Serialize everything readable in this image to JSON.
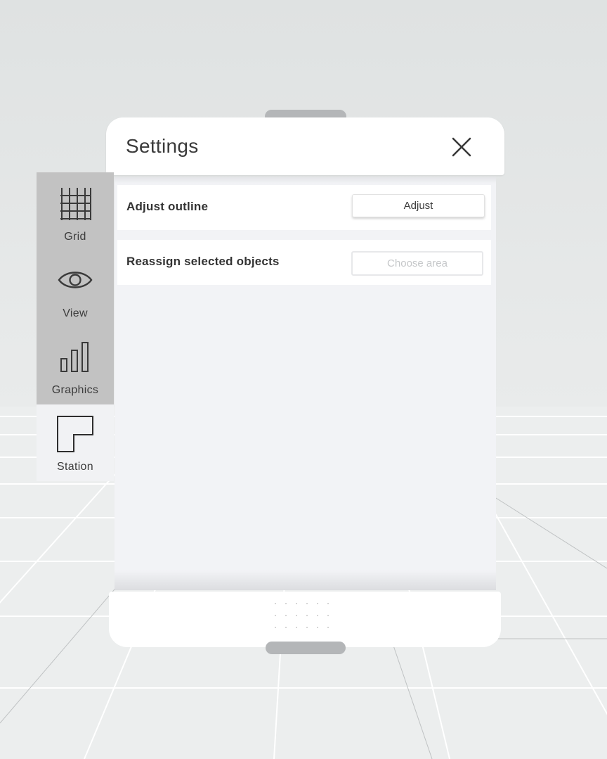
{
  "panel": {
    "title": "Settings"
  },
  "sidebar": {
    "tabs": [
      {
        "label": "Grid",
        "icon": "grid-icon",
        "active": false
      },
      {
        "label": "View",
        "icon": "eye-icon",
        "active": false
      },
      {
        "label": "Graphics",
        "icon": "bar-chart-icon",
        "active": false
      },
      {
        "label": "Station",
        "icon": "station-outline-icon",
        "active": true
      }
    ]
  },
  "settings": {
    "rows": [
      {
        "label": "Adjust outline",
        "button": "Adjust",
        "enabled": true
      },
      {
        "label": "Reassign selected objects",
        "button": "Choose area",
        "enabled": false
      }
    ]
  },
  "colors": {
    "sidebar_bg": "#c2c2c2",
    "active_tab_bg": "#f1f2f4",
    "panel_bg": "#ffffff",
    "content_bg": "#f2f3f6",
    "handle": "#b4b6b8",
    "disabled_text": "#c5c7c9"
  }
}
